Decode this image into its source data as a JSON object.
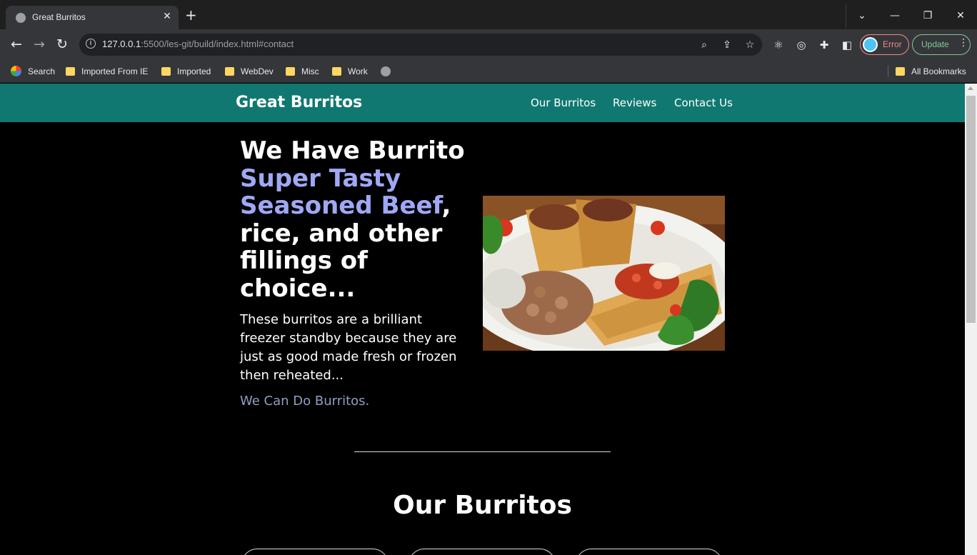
{
  "browser": {
    "tab_title": "Great Burritos",
    "url_host": "127.0.0.1",
    "url_rest": ":5500/les-git/build/index.html#contact",
    "profile_status": "Error",
    "update_label": "Update",
    "bookmarks": [
      "Search",
      "Imported From IE",
      "Imported",
      "WebDev",
      "Misc",
      "Work"
    ],
    "all_bookmarks": "All Bookmarks"
  },
  "site": {
    "brand": "Great Burritos",
    "nav": [
      "Our Burritos",
      "Reviews",
      "Contact Us"
    ],
    "hero": {
      "title_line1": "We Have Burrito",
      "title_accent": "Super Tasty Seasoned Beef",
      "title_rest": ", rice, and other fillings of choice...",
      "description": "These burritos are a brilliant freezer standby because they are just as good made fresh or frozen then reheated...",
      "tagline": "We Can Do Burritos."
    },
    "section_title": "Our Burritos"
  },
  "colors": {
    "header_bg": "#107870",
    "accent_text": "#9fa8f5",
    "tagline": "#8f9fc2"
  }
}
